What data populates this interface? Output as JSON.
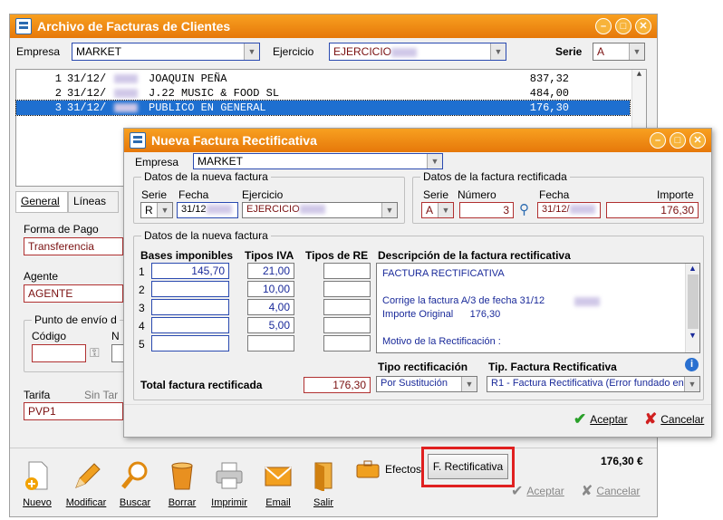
{
  "main_window": {
    "title": "Archivo de Facturas de Clientes",
    "empresa_label": "Empresa",
    "empresa_value": "MARKET",
    "ejercicio_label": "Ejercicio",
    "ejercicio_value": "EJERCICIO",
    "serie_label": "Serie",
    "serie_value": "A",
    "invoice_list": [
      {
        "num": "1",
        "date": "31/12/",
        "client": "JOAQUIN PEÑA",
        "amount": "837,32"
      },
      {
        "num": "2",
        "date": "31/12/",
        "client": "J.22 MUSIC & FOOD SL",
        "amount": "484,00"
      },
      {
        "num": "3",
        "date": "31/12/",
        "client": "PUBLICO EN GENERAL",
        "amount": "176,30"
      }
    ],
    "tabs": [
      "General",
      "Líneas"
    ],
    "forma_pago_label": "Forma de Pago",
    "forma_pago_value": "Transferencia",
    "agente_label": "Agente",
    "agente_value": "AGENTE",
    "punto_envio_label": "Punto de envío d",
    "codigo_label": "Código",
    "n_label": "N",
    "tarifa_label": "Tarifa",
    "sin_tarifa_label": "Sin Tar",
    "tarifa_value": "PVP1",
    "toolbar": {
      "nuevo": "Nuevo",
      "modificar": "Modificar",
      "buscar": "Buscar",
      "borrar": "Borrar",
      "imprimir": "Imprimir",
      "email": "Email",
      "salir": "Salir",
      "efectos": "Efectos",
      "rectificativa": "F. Rectificativa"
    },
    "total": "176,30 €",
    "aceptar": "Aceptar",
    "cancelar": "Cancelar"
  },
  "dialog": {
    "title": "Nueva Factura Rectificativa",
    "empresa_label": "Empresa",
    "empresa_value": "MARKET",
    "nueva_group_label": "Datos de la nueva factura",
    "serie_label": "Serie",
    "serie_value": "R",
    "fecha_label": "Fecha",
    "fecha_value": "31/12",
    "ejercicio_label": "Ejercicio",
    "ejercicio_value": "EJERCICIO",
    "rectificada_group_label": "Datos de la factura rectificada",
    "r_serie_label": "Serie",
    "r_serie_value": "A",
    "r_numero_label": "Número",
    "r_numero_value": "3",
    "r_fecha_label": "Fecha",
    "r_fecha_value": "31/12/",
    "r_importe_label": "Importe",
    "r_importe_value": "176,30",
    "datos_group_label": "Datos de la nueva factura",
    "bases_label": "Bases imponibles",
    "tipos_iva_label": "Tipos IVA",
    "tipos_re_label": "Tipos de RE",
    "rows": [
      {
        "n": "1",
        "base": "145,70",
        "iva": "21,00"
      },
      {
        "n": "2",
        "base": "",
        "iva": "10,00"
      },
      {
        "n": "3",
        "base": "",
        "iva": "4,00"
      },
      {
        "n": "4",
        "base": "",
        "iva": "5,00"
      },
      {
        "n": "5",
        "base": "",
        "iva": ""
      }
    ],
    "descripcion_label": "Descripción de la factura rectificativa",
    "descripcion_lines": [
      "FACTURA RECTIFICATIVA",
      "",
      "Corrige la factura A/3 de fecha 31/12",
      "Importe Original      176,30",
      "",
      "Motivo de la Rectificación :"
    ],
    "total_label": "Total factura rectificada",
    "total_value": "176,30",
    "tipo_rect_label": "Tipo rectificación",
    "tipo_rect_value": "Por Sustitución",
    "tip_factura_label": "Tip. Factura Rectificativa",
    "tip_factura_value": "R1 - Factura Rectificativa (Error fundado en",
    "aceptar": "Aceptar",
    "cancelar": "Cancelar"
  },
  "colors": {
    "title_orange": "#f08a14",
    "selection_blue": "#1e6fd0",
    "highlight_red": "#e02020"
  }
}
